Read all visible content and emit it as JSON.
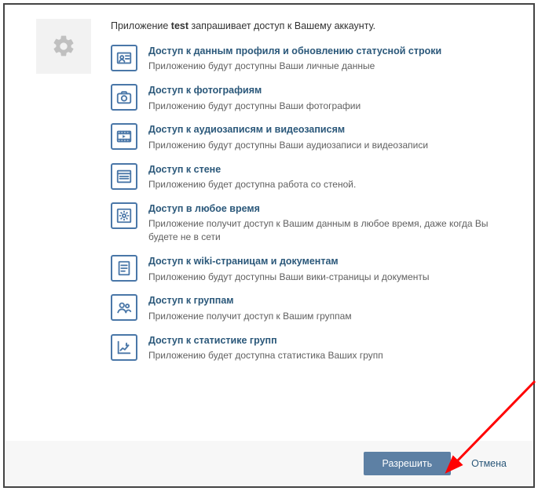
{
  "intro": {
    "prefix": "Приложение ",
    "app_name": "test",
    "suffix": " запрашивает доступ к Вашему аккаунту."
  },
  "permissions": [
    {
      "icon": "profile-card-icon",
      "title": "Доступ к данным профиля и обновлению статусной строки",
      "desc": "Приложению будут доступны Ваши личные данные"
    },
    {
      "icon": "camera-icon",
      "title": "Доступ к фотографиям",
      "desc": "Приложению будут доступны Ваши фотографии"
    },
    {
      "icon": "media-icon",
      "title": "Доступ к аудиозаписям и видеозаписям",
      "desc": "Приложению будут доступны Ваши аудиозаписи и видеозаписи"
    },
    {
      "icon": "wall-icon",
      "title": "Доступ к стене",
      "desc": "Приложению будет доступна работа со стеной."
    },
    {
      "icon": "gear-box-icon",
      "title": "Доступ в любое время",
      "desc": "Приложение получит доступ к Вашим данным в любое время, даже когда Вы будете не в сети"
    },
    {
      "icon": "document-icon",
      "title": "Доступ к wiki-страницам и документам",
      "desc": "Приложению будут доступны Ваши вики-страницы и документы"
    },
    {
      "icon": "groups-icon",
      "title": "Доступ к группам",
      "desc": "Приложение получит доступ к Вашим группам"
    },
    {
      "icon": "stats-icon",
      "title": "Доступ к статистике групп",
      "desc": "Приложению будет доступна статистика Ваших групп"
    }
  ],
  "footer": {
    "allow": "Разрешить",
    "cancel": "Отмена"
  },
  "colors": {
    "accent": "#4a77a8",
    "link": "#2b587a"
  }
}
